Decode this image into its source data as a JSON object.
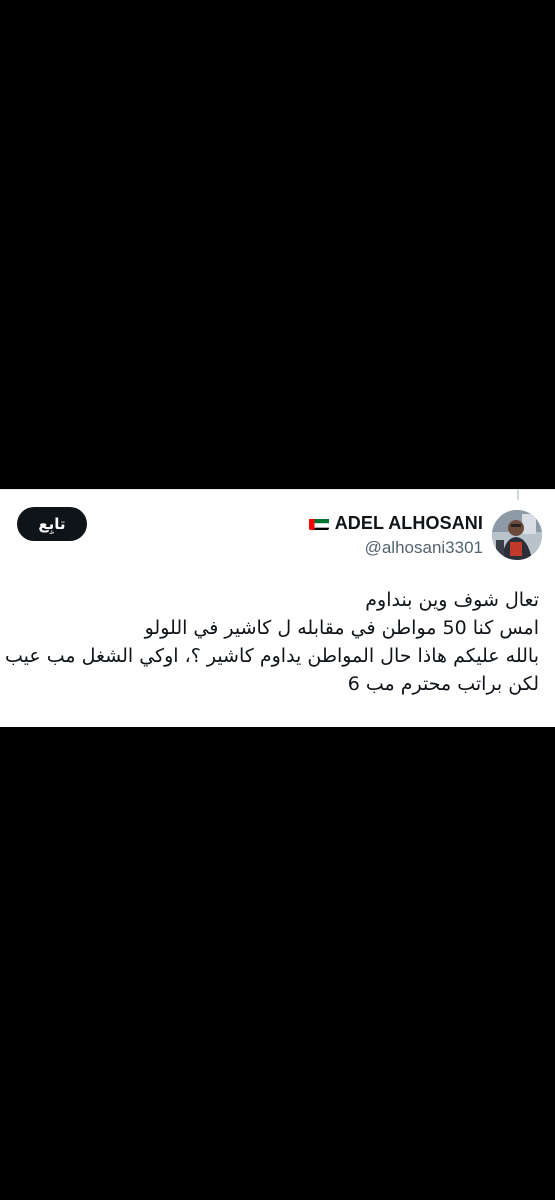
{
  "tweet": {
    "author": {
      "display_name": "ADEL ALHOSANI",
      "handle": "@alhosani3301",
      "flag_icon": "uae-flag-icon",
      "avatar_icon": "profile-avatar-icon"
    },
    "follow_label": "تابِع",
    "text_lines": [
      "تعال شوف وين بنداوم",
      "امس كنا 50 مواطن في مقابله ل كاشير في اللولو",
      "بالله عليكم هاذا حال المواطن يداوم كاشير ؟، اوكي الشغل مب عيب",
      "لكن براتب محترم مب 6"
    ]
  },
  "colors": {
    "background": "#000000",
    "card": "#ffffff",
    "text": "#0f1419",
    "secondary_text": "#536471",
    "follow_button": "#0f1419"
  }
}
